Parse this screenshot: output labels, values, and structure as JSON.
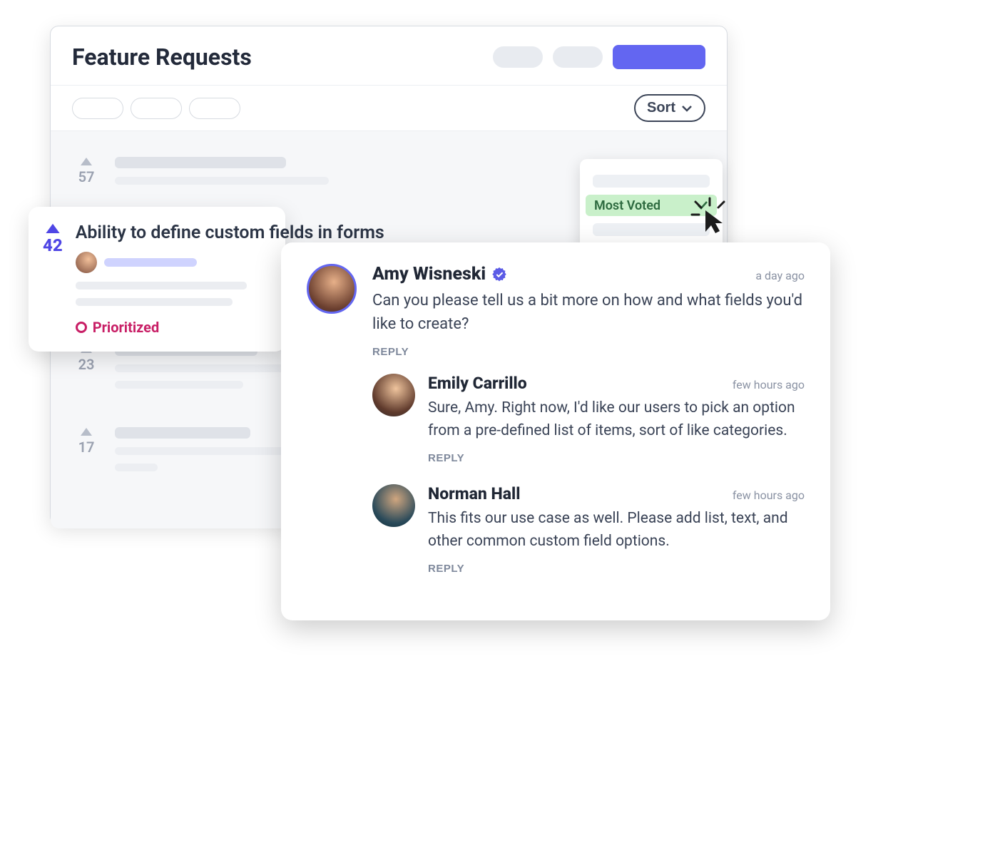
{
  "pageTitle": "Feature Requests",
  "sort": {
    "buttonLabel": "Sort",
    "selectedLabel": "Most Voted"
  },
  "listItems": [
    {
      "votes": 57
    },
    {
      "votes": 23
    },
    {
      "votes": 17
    }
  ],
  "highlighted": {
    "votes": 42,
    "title": "Ability to define custom fields in forms",
    "statusLabel": "Prioritized"
  },
  "comments": {
    "main": {
      "author": "Amy Wisneski",
      "verified": true,
      "time": "a day ago",
      "text": "Can you please tell us a bit more on how and what fields you'd like to create?",
      "replyLabel": "REPLY"
    },
    "replies": [
      {
        "author": "Emily Carrillo",
        "time": "few hours ago",
        "text": "Sure, Amy. Right now, I'd like our users to pick an option from a pre-defined list of items, sort of like categories.",
        "replyLabel": "REPLY"
      },
      {
        "author": "Norman Hall",
        "time": "few hours ago",
        "text": "This fits our use case as well. Please add list, text, and other common custom field options.",
        "replyLabel": "REPLY"
      }
    ]
  }
}
